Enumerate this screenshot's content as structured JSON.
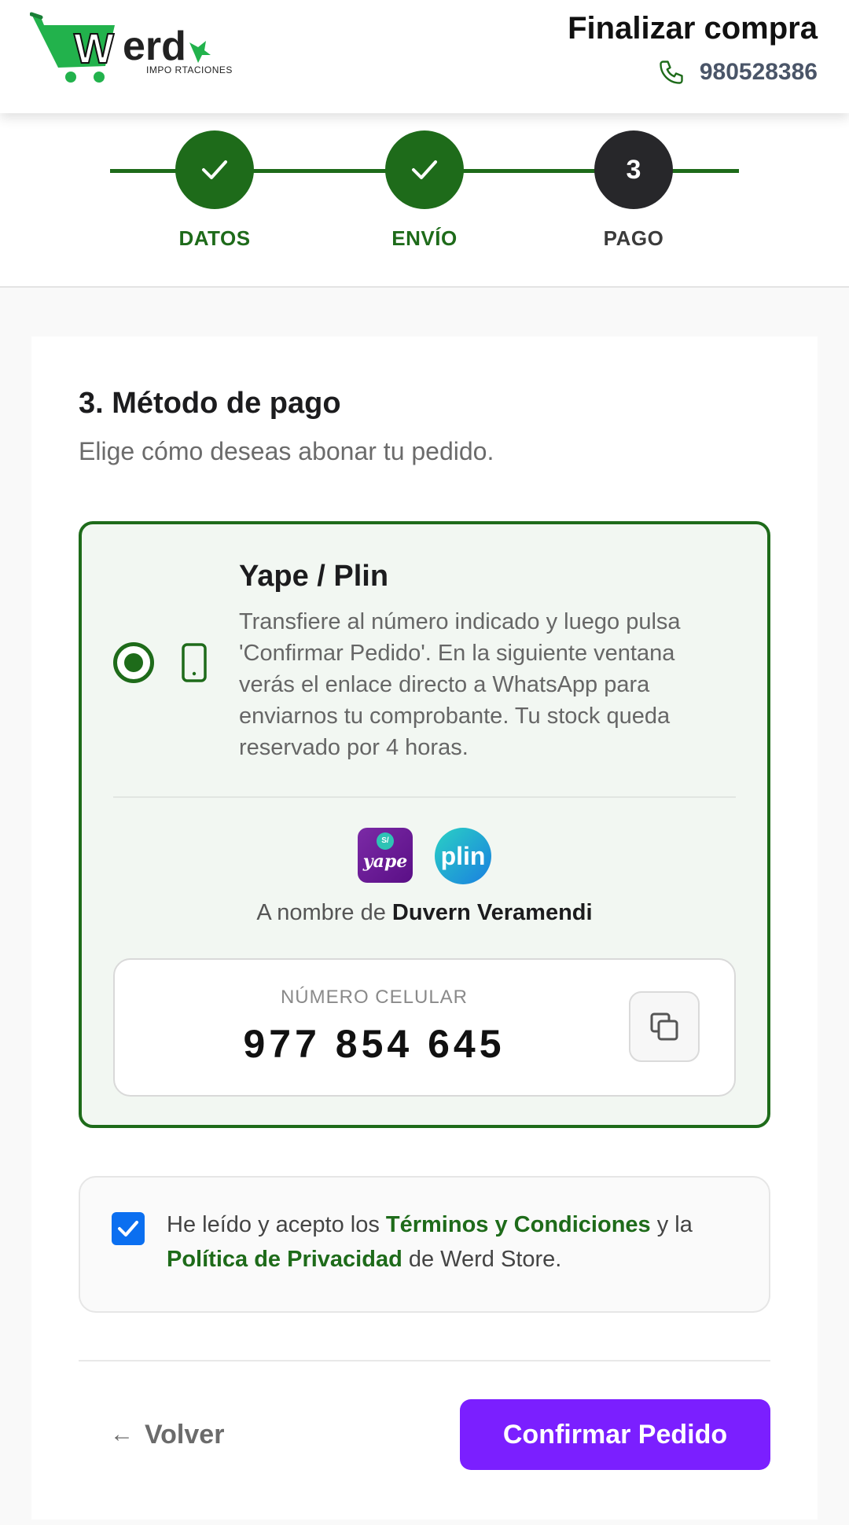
{
  "header": {
    "brand": "erd",
    "brand_sub": "IMPO RTACIONES",
    "title": "Finalizar compra",
    "phone": "980528386",
    "phone_icon": "phone-icon"
  },
  "stepper": {
    "steps": [
      {
        "label": "DATOS",
        "status": "done",
        "icon": "check-icon"
      },
      {
        "label": "ENVÍO",
        "status": "done",
        "icon": "check-icon"
      },
      {
        "label": "PAGO",
        "status": "current",
        "number": "3"
      }
    ],
    "colors": {
      "done": "#1e6b1a",
      "current": "#27272a"
    }
  },
  "payment": {
    "title": "3. Método de pago",
    "subtitle": "Elige cómo deseas abonar tu pedido.",
    "method": {
      "name": "Yape / Plin",
      "selected": true,
      "icon": "mobile-phone-icon",
      "description": "Transfiere al número indicado y luego pulsa 'Confirmar Pedido'. En la siguiente ventana verás el enlace directo a WhatsApp para enviarnos tu comprobante. Tu stock queda reservado por 4 horas.",
      "logos": {
        "yape_badge": "S/",
        "yape": "yape",
        "plin": "plin"
      },
      "holder_prefix": "A nombre de",
      "holder_name": "Duvern Veramendi",
      "number_label": "NÚMERO CELULAR",
      "number": "977 854 645",
      "copy_icon": "copy-icon"
    }
  },
  "terms": {
    "checked": true,
    "part1": "He leído y acepto los ",
    "link1": "Términos y Condiciones",
    "part2": " y la ",
    "link2": "Política de Privacidad",
    "part3": " de Werd Store."
  },
  "actions": {
    "back_arrow": "←",
    "back_label": "Volver",
    "confirm_label": "Confirmar Pedido",
    "confirm_color": "#7b1fff"
  }
}
